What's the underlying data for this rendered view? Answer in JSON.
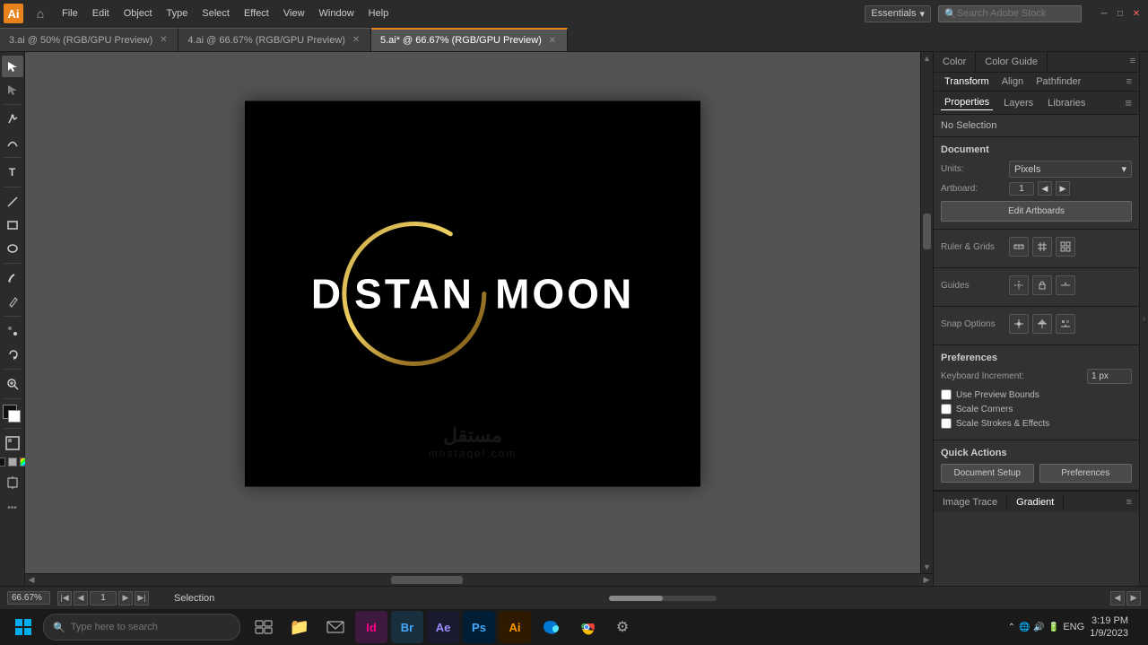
{
  "app": {
    "title": "Adobe Illustrator",
    "icon_text": "Ai",
    "workspace": "Essentials",
    "search_placeholder": "Search Adobe Stock"
  },
  "menu": {
    "items": [
      "File",
      "Edit",
      "Object",
      "Type",
      "Select",
      "Effect",
      "View",
      "Window",
      "Help"
    ]
  },
  "tabs": [
    {
      "id": "tab1",
      "label": "3.ai @ 50% (RGB/GPU Preview)",
      "active": false
    },
    {
      "id": "tab2",
      "label": "4.ai @ 66.67% (RGB/GPU Preview)",
      "active": false
    },
    {
      "id": "tab3",
      "label": "5.ai* @ 66.67% (RGB/GPU Preview)",
      "active": true
    }
  ],
  "canvas": {
    "artboard_label": "",
    "logo": {
      "left_text": "D",
      "center_text": "STAN",
      "right_text": "MOON"
    }
  },
  "right_panel": {
    "top_tabs": [
      {
        "label": "Color",
        "active": false
      },
      {
        "label": "Color Guide",
        "active": false
      }
    ],
    "transform_tabs": [
      {
        "label": "Transform",
        "active": true
      },
      {
        "label": "Align",
        "active": false
      },
      {
        "label": "Pathfinder",
        "active": false
      }
    ],
    "properties_tabs": [
      {
        "label": "Properties",
        "active": true
      },
      {
        "label": "Layers",
        "active": false
      },
      {
        "label": "Libraries",
        "active": false
      }
    ],
    "no_selection": "No Selection",
    "document_section": {
      "title": "Document",
      "units_label": "Units:",
      "units_value": "Pixels",
      "artboard_label": "Artboard:",
      "artboard_value": "1",
      "edit_artboards_btn": "Edit Artboards"
    },
    "ruler_grids": {
      "title": "Ruler & Grids"
    },
    "guides": {
      "title": "Guides"
    },
    "snap_options": {
      "title": "Snap Options"
    },
    "preferences": {
      "title": "Preferences",
      "keyboard_increment_label": "Keyboard Increment:",
      "keyboard_increment_value": "1 px",
      "use_preview_bounds": "Use Preview Bounds",
      "scale_corners": "Scale Corners",
      "scale_strokes": "Scale Strokes & Effects"
    },
    "quick_actions": {
      "title": "Quick Actions",
      "document_setup_btn": "Document Setup",
      "preferences_btn": "Preferences"
    }
  },
  "footer_tabs": [
    {
      "label": "Image Trace",
      "active": false
    },
    {
      "label": "Gradient",
      "active": true
    }
  ],
  "status_bar": {
    "zoom_value": "66.67%",
    "artboard_num": "1",
    "selection_label": "Selection"
  },
  "taskbar": {
    "search_placeholder": "Type here to search",
    "apps": [
      "📁",
      "📧",
      "🎨",
      "🖼️",
      "🎬",
      "🖋️",
      "🌐",
      "🔴"
    ],
    "time": "3:19 PM",
    "date": "1/9/2023"
  }
}
